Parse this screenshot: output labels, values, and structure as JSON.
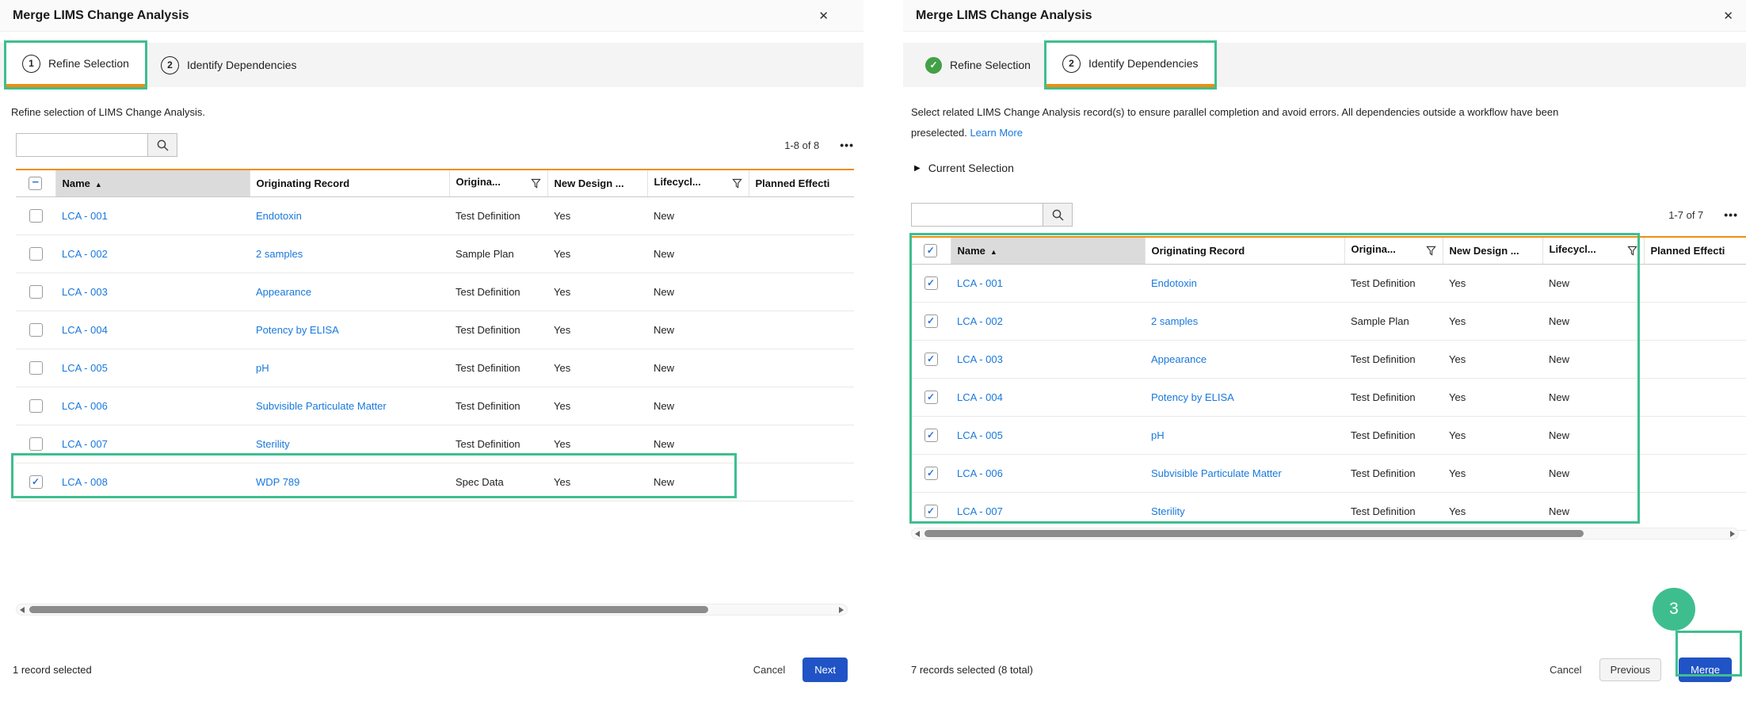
{
  "colors": {
    "accent_orange": "#F08E0F",
    "highlight_green": "#3EBE8F",
    "completed_green": "#43A047",
    "primary_blue": "#2053C5",
    "link_blue": "#1878DC"
  },
  "left_dialog": {
    "title": "Merge LIMS Change Analysis",
    "close_icon": "✕",
    "tabs": [
      {
        "number": "1",
        "label": "Refine Selection",
        "state": "active"
      },
      {
        "number": "2",
        "label": "Identify Dependencies",
        "state": "upcoming"
      }
    ],
    "description": "Refine selection of LIMS Change Analysis.",
    "search_value": "",
    "pagination": "1-8 of 8",
    "more_icon": "•••",
    "table": {
      "header_checkbox": "indeterminate",
      "columns": [
        {
          "key": "checkbox",
          "type": "checkbox"
        },
        {
          "key": "name",
          "label": "Name",
          "sort_icon": "▲",
          "highlighted": true
        },
        {
          "key": "originating-record",
          "label": "Originating Record"
        },
        {
          "key": "origina",
          "label": "Origina...",
          "filter": true
        },
        {
          "key": "new-design",
          "label": "New Design ..."
        },
        {
          "key": "lifecycl",
          "label": "Lifecycl...",
          "filter": true
        },
        {
          "key": "planned",
          "label": "Planned Effecti"
        }
      ],
      "rows": [
        {
          "checked": false,
          "name": "LCA - 001",
          "originating_record": "Endotoxin",
          "origina": "Test Definition",
          "new_design": "Yes",
          "lifecycl": "New",
          "planned": ""
        },
        {
          "checked": false,
          "name": "LCA - 002",
          "originating_record": "2 samples",
          "origina": "Sample Plan",
          "new_design": "Yes",
          "lifecycl": "New",
          "planned": ""
        },
        {
          "checked": false,
          "name": "LCA - 003",
          "originating_record": "Appearance",
          "origina": "Test Definition",
          "new_design": "Yes",
          "lifecycl": "New",
          "planned": ""
        },
        {
          "checked": false,
          "name": "LCA - 004",
          "originating_record": "Potency by ELISA",
          "origina": "Test Definition",
          "new_design": "Yes",
          "lifecycl": "New",
          "planned": ""
        },
        {
          "checked": false,
          "name": "LCA - 005",
          "originating_record": "pH",
          "origina": "Test Definition",
          "new_design": "Yes",
          "lifecycl": "New",
          "planned": ""
        },
        {
          "checked": false,
          "name": "LCA - 006",
          "originating_record": "Subvisible Particulate Matter",
          "origina": "Test Definition",
          "new_design": "Yes",
          "lifecycl": "New",
          "planned": ""
        },
        {
          "checked": false,
          "name": "LCA - 007",
          "originating_record": "Sterility",
          "origina": "Test Definition",
          "new_design": "Yes",
          "lifecycl": "New",
          "planned": ""
        },
        {
          "checked": true,
          "name": "LCA - 008",
          "originating_record": "WDP 789",
          "origina": "Spec Data",
          "new_design": "Yes",
          "lifecycl": "New",
          "planned": ""
        }
      ]
    },
    "footer": {
      "status": "1 record selected",
      "cancel_label": "Cancel",
      "next_label": "Next"
    }
  },
  "right_dialog": {
    "title": "Merge LIMS Change Analysis",
    "close_icon": "✕",
    "tabs": [
      {
        "icon": "✓",
        "label": "Refine Selection",
        "state": "completed"
      },
      {
        "number": "2",
        "label": "Identify Dependencies",
        "state": "active"
      }
    ],
    "description": {
      "line1": "Select related LIMS Change Analysis record(s) to ensure parallel completion and avoid errors. All dependencies outside a workflow have been",
      "line2": "preselected.",
      "link_label": "Learn More"
    },
    "current_selection": {
      "icon": "▶",
      "label": "Current Selection"
    },
    "search_value": "",
    "pagination": "1-7 of 7",
    "more_icon": "•••",
    "table": {
      "header_checkbox": "checked",
      "columns": [
        {
          "key": "checkbox",
          "type": "checkbox"
        },
        {
          "key": "name",
          "label": "Name",
          "sort_icon": "▲",
          "highlighted": true
        },
        {
          "key": "originating-record",
          "label": "Originating Record"
        },
        {
          "key": "origina",
          "label": "Origina...",
          "filter": true
        },
        {
          "key": "new-design",
          "label": "New Design ..."
        },
        {
          "key": "lifecycl",
          "label": "Lifecycl...",
          "filter": true
        },
        {
          "key": "planned",
          "label": "Planned Effecti"
        }
      ],
      "rows": [
        {
          "checked": true,
          "name": "LCA - 001",
          "originating_record": "Endotoxin",
          "origina": "Test Definition",
          "new_design": "Yes",
          "lifecycl": "New",
          "planned": ""
        },
        {
          "checked": true,
          "name": "LCA - 002",
          "originating_record": "2 samples",
          "origina": "Sample Plan",
          "new_design": "Yes",
          "lifecycl": "New",
          "planned": ""
        },
        {
          "checked": true,
          "name": "LCA - 003",
          "originating_record": "Appearance",
          "origina": "Test Definition",
          "new_design": "Yes",
          "lifecycl": "New",
          "planned": ""
        },
        {
          "checked": true,
          "name": "LCA - 004",
          "originating_record": "Potency by ELISA",
          "origina": "Test Definition",
          "new_design": "Yes",
          "lifecycl": "New",
          "planned": ""
        },
        {
          "checked": true,
          "name": "LCA - 005",
          "originating_record": "pH",
          "origina": "Test Definition",
          "new_design": "Yes",
          "lifecycl": "New",
          "planned": ""
        },
        {
          "checked": true,
          "name": "LCA - 006",
          "originating_record": "Subvisible Particulate Matter",
          "origina": "Test Definition",
          "new_design": "Yes",
          "lifecycl": "New",
          "planned": ""
        },
        {
          "checked": true,
          "name": "LCA - 007",
          "originating_record": "Sterility",
          "origina": "Test Definition",
          "new_design": "Yes",
          "lifecycl": "New",
          "planned": ""
        }
      ]
    },
    "step_badge": "3",
    "footer": {
      "status": "7 records selected (8 total)",
      "cancel_label": "Cancel",
      "previous_label": "Previous",
      "merge_label": "Merge"
    }
  }
}
